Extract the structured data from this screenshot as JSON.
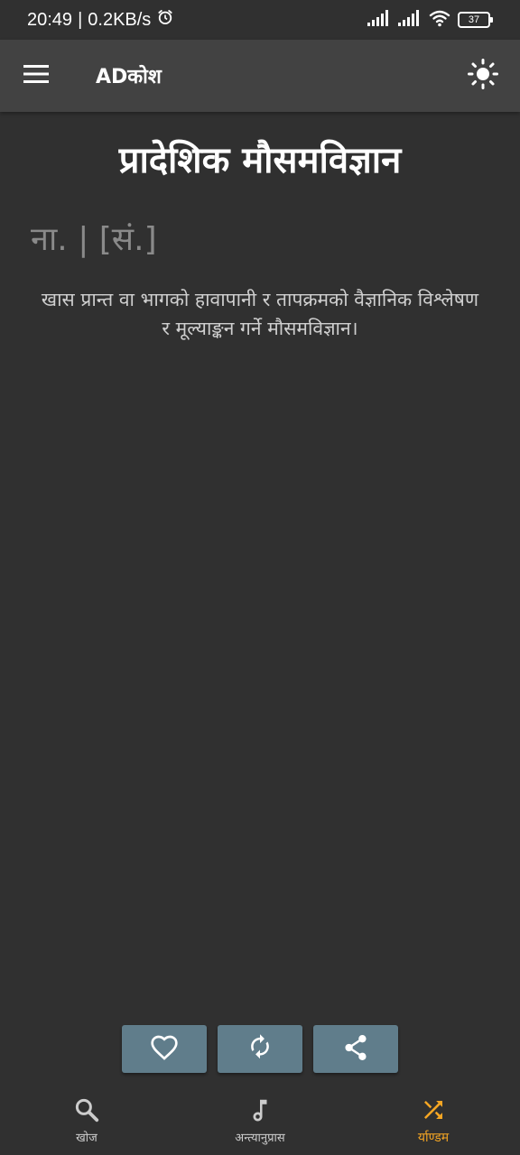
{
  "status_bar": {
    "time": "20:49",
    "speed": "0.2KB/s",
    "battery": "37"
  },
  "app_bar": {
    "title": "ADकोश"
  },
  "word": {
    "title": "प्रादेशिक मौसमविज्ञान",
    "meta": "ना. | [सं.]",
    "definition": "खास प्रान्त वा भागको हावापानी र तापक्रमको वैज्ञानिक विश्लेषण र मूल्याङ्कन गर्ने मौसमविज्ञान।"
  },
  "actions": {
    "favorite_icon": "heart-outline-icon",
    "refresh_icon": "refresh-icon",
    "share_icon": "share-icon",
    "button_color": "#607d8b"
  },
  "bottom_nav": {
    "items": [
      {
        "label": "खोज",
        "icon": "search-icon"
      },
      {
        "label": "अन्त्यानुप्रास",
        "icon": "music-note-icon"
      },
      {
        "label": "र्याण्डम",
        "icon": "shuffle-icon"
      }
    ],
    "active_index": 2,
    "active_color": "#f5a623"
  },
  "colors": {
    "background": "#303030",
    "app_bar": "#424242",
    "meta_text": "#8a8a8a"
  }
}
